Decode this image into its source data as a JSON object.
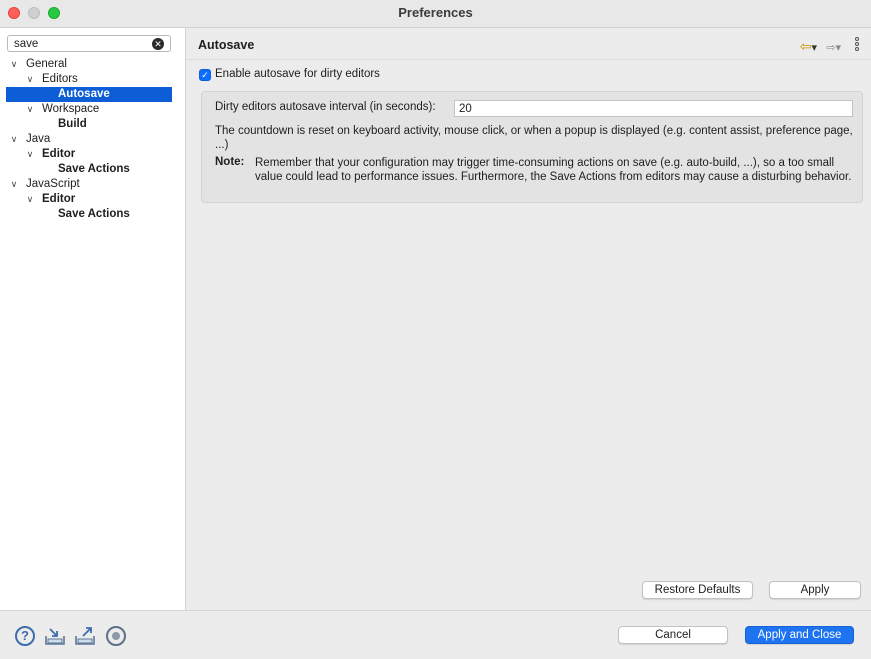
{
  "window": {
    "title": "Preferences"
  },
  "sidebar": {
    "filter_value": "save",
    "tree": [
      {
        "label": "General",
        "level": 0,
        "expanded": true,
        "bold": false,
        "selected": false
      },
      {
        "label": "Editors",
        "level": 1,
        "expanded": true,
        "bold": false,
        "selected": false
      },
      {
        "label": "Autosave",
        "level": 2,
        "expanded": null,
        "bold": true,
        "selected": true
      },
      {
        "label": "Workspace",
        "level": 1,
        "expanded": true,
        "bold": false,
        "selected": false
      },
      {
        "label": "Build",
        "level": 2,
        "expanded": null,
        "bold": true,
        "selected": false
      },
      {
        "label": "Java",
        "level": 0,
        "expanded": true,
        "bold": false,
        "selected": false
      },
      {
        "label": "Editor",
        "level": 1,
        "expanded": true,
        "bold": true,
        "selected": false
      },
      {
        "label": "Save Actions",
        "level": 2,
        "expanded": null,
        "bold": true,
        "selected": false
      },
      {
        "label": "JavaScript",
        "level": 0,
        "expanded": true,
        "bold": false,
        "selected": false
      },
      {
        "label": "Editor",
        "level": 1,
        "expanded": true,
        "bold": true,
        "selected": false
      },
      {
        "label": "Save Actions",
        "level": 2,
        "expanded": null,
        "bold": true,
        "selected": false
      }
    ]
  },
  "main": {
    "page_title": "Autosave",
    "enable_checkbox": {
      "label": "Enable autosave for dirty editors",
      "checked": true
    },
    "interval": {
      "label": "Dirty editors autosave interval (in seconds):",
      "value": "20"
    },
    "countdown_text": "The countdown is reset on keyboard activity, mouse click, or when a popup is displayed (e.g. content assist, preference page, ...)",
    "note_label": "Note:",
    "note_text": "Remember that your configuration may trigger time-consuming actions on save (e.g. auto-build, ...), so a too small value could lead to performance issues. Furthermore, the Save Actions from editors may cause a disturbing behavior.",
    "restore_defaults_label": "Restore Defaults",
    "apply_label": "Apply"
  },
  "footer": {
    "cancel_label": "Cancel",
    "apply_close_label": "Apply and Close",
    "icons": [
      "help-icon",
      "import-icon",
      "export-icon",
      "record-icon"
    ]
  },
  "colors": {
    "selection": "#0d5dd6",
    "primary_button": "#1d73f0",
    "checkbox": "#0d6efd"
  }
}
